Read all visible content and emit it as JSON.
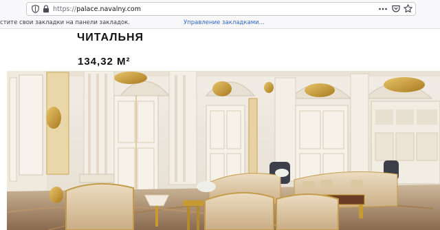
{
  "browser": {
    "url_scheme": "https://",
    "url_host": "palace.navalny.com",
    "bookmarks_hint": "стите свои закладки на панели закладок.",
    "bookmarks_manage_link": "Управление закладками..."
  },
  "page": {
    "room_name": "ЧИТАЛЬНЯ",
    "room_area": "134,32 М²"
  },
  "colors": {
    "gold": "#c89a32",
    "ivory": "#f3eee4",
    "link_blue": "#2d64c4"
  }
}
